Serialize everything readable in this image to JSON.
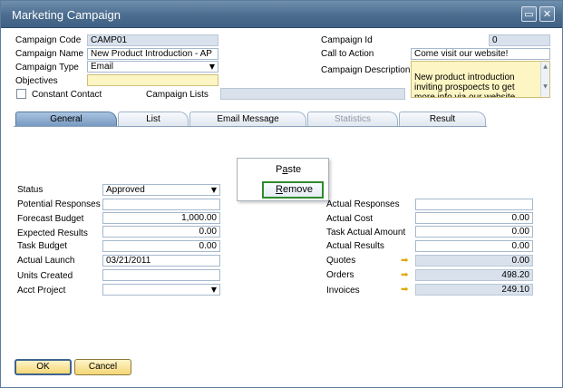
{
  "window": {
    "title": "Marketing Campaign",
    "minimize_glyph": "▭",
    "close_glyph": "✕"
  },
  "header": {
    "campaign_code_label": "Campaign Code",
    "campaign_code": "CAMP01",
    "campaign_name_label": "Campaign Name",
    "campaign_name": "New Product Introduction - AP",
    "campaign_type_label": "Campaign Type",
    "campaign_type": "Email",
    "objectives_label": "Objectives",
    "objectives": "",
    "constant_contact_label": "Constant Contact",
    "campaign_lists_label": "Campaign Lists",
    "campaign_lists": "",
    "campaign_id_label": "Campaign Id",
    "campaign_id": "0",
    "call_to_action_label": "Call to Action",
    "call_to_action": "Come visit our website!",
    "campaign_description_label": "Campaign Description",
    "campaign_description": "New product introduction\ninviting prospoects to get\nmore info via our website"
  },
  "tabs": [
    {
      "label": "General"
    },
    {
      "label": "List"
    },
    {
      "label": "Email Message"
    },
    {
      "label": "Statistics"
    },
    {
      "label": "Result"
    }
  ],
  "context_menu": {
    "paste_pre": "P",
    "paste_u": "a",
    "paste_post": "ste",
    "remove_u": "R",
    "remove_post": "emove"
  },
  "general": {
    "status_label": "Status",
    "status": "Approved",
    "potential_responses_label": "Potential Responses",
    "potential_responses": "",
    "forecast_budget_label": "Forecast Budget",
    "forecast_budget": "1,000.00",
    "expected_results_label": "Expected Results",
    "expected_results": "0.00",
    "task_budget_label": "Task Budget",
    "task_budget": "0.00",
    "actual_launch_label": "Actual Launch",
    "actual_launch": "03/21/2011",
    "units_created_label": "Units Created",
    "units_created": "",
    "acct_project_label": "Acct Project",
    "acct_project": "",
    "actual_responses_label": "Actual Responses",
    "actual_responses": "",
    "actual_cost_label": "Actual Cost",
    "actual_cost": "0.00",
    "task_actual_amount_label": "Task Actual Amount",
    "task_actual_amount": "0.00",
    "actual_results_label": "Actual Results",
    "actual_results": "0.00",
    "quotes_label": "Quotes",
    "quotes": "0.00",
    "orders_label": "Orders",
    "orders": "498.20",
    "invoices_label": "Invoices",
    "invoices": "249.10"
  },
  "buttons": {
    "ok": "OK",
    "cancel": "Cancel"
  },
  "colors": {
    "title_bar": "#4b6c8e",
    "required_field": "#fdf5c3",
    "readonly_field": "#d9e2ec",
    "highlight_border": "#2e8b2e"
  }
}
